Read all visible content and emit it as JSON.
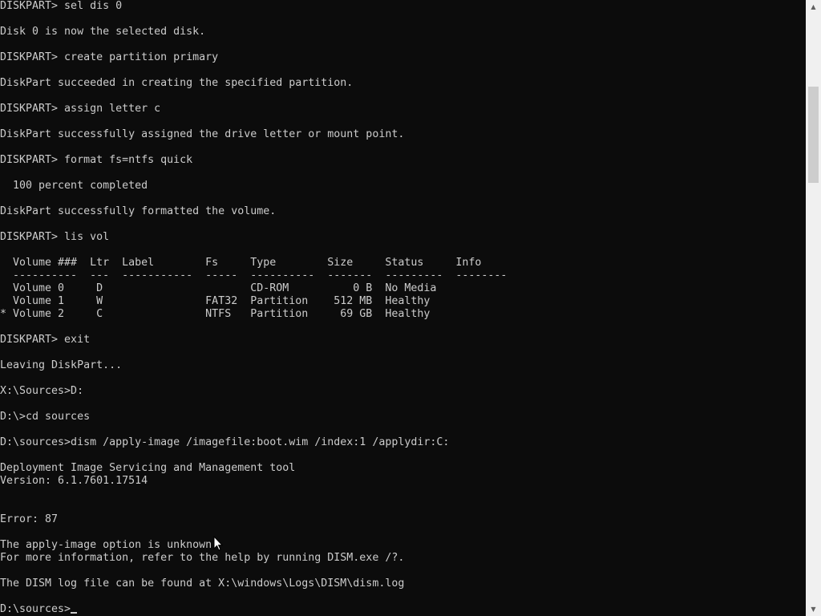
{
  "console": {
    "lines": [
      "DISKPART> sel dis 0",
      "",
      "Disk 0 is now the selected disk.",
      "",
      "DISKPART> create partition primary",
      "",
      "DiskPart succeeded in creating the specified partition.",
      "",
      "DISKPART> assign letter c",
      "",
      "DiskPart successfully assigned the drive letter or mount point.",
      "",
      "DISKPART> format fs=ntfs quick",
      "",
      "  100 percent completed",
      "",
      "DiskPart successfully formatted the volume.",
      "",
      "DISKPART> lis vol",
      "",
      "  Volume ###  Ltr  Label        Fs     Type        Size     Status     Info",
      "  ----------  ---  -----------  -----  ----------  -------  ---------  --------",
      "  Volume 0     D                       CD-ROM          0 B  No Media",
      "  Volume 1     W                FAT32  Partition    512 MB  Healthy",
      "* Volume 2     C                NTFS   Partition     69 GB  Healthy",
      "",
      "DISKPART> exit",
      "",
      "Leaving DiskPart...",
      "",
      "X:\\Sources>D:",
      "",
      "D:\\>cd sources",
      "",
      "D:\\sources>dism /apply-image /imagefile:boot.wim /index:1 /applydir:C:",
      "",
      "Deployment Image Servicing and Management tool",
      "Version: 6.1.7601.17514",
      "",
      "",
      "Error: 87",
      "",
      "The apply-image option is unknown.",
      "For more information, refer to the help by running DISM.exe /?.",
      "",
      "The DISM log file can be found at X:\\windows\\Logs\\DISM\\dism.log",
      "",
      "D:\\sources>"
    ]
  },
  "icons": {
    "scroll_up": "scroll-up-arrow-icon",
    "scroll_down": "scroll-down-arrow-icon",
    "pointer": "mouse-pointer-icon"
  },
  "colors": {
    "background": "#0c0c0c",
    "text": "#cccccc",
    "scrollbar_track": "#f0f0f0",
    "scrollbar_thumb": "#cdcdcd"
  }
}
